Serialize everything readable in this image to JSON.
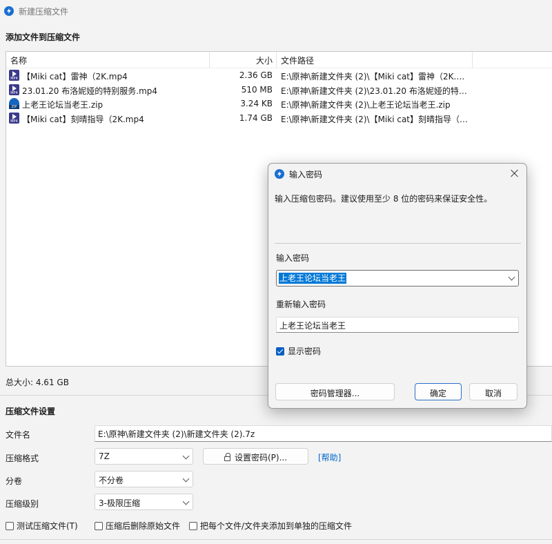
{
  "window": {
    "title": "新建压缩文件"
  },
  "add_section": {
    "title": "添加文件到压缩文件"
  },
  "file_list": {
    "columns": {
      "name": "名称",
      "size": "大小",
      "path": "文件路径"
    },
    "rows": [
      {
        "icon": "mp4-file-icon",
        "name": "【Miki cat】雷神（2K.mp4",
        "size": "2.36 GB",
        "path": "E:\\原神\\新建文件夹 (2)\\【Miki cat】雷神（2K.mp4"
      },
      {
        "icon": "mp4-file-icon",
        "name": "23.01.20 布洛妮娅的特别服务.mp4",
        "size": "510 MB",
        "path": "E:\\原神\\新建文件夹 (2)\\23.01.20 布洛妮娅的特别..."
      },
      {
        "icon": "zip-file-icon",
        "name": "上老王论坛当老王.zip",
        "size": "3.24 KB",
        "path": "E:\\原神\\新建文件夹 (2)\\上老王论坛当老王.zip"
      },
      {
        "icon": "mp4-file-icon",
        "name": "【Miki cat】刻晴指导（2K.mp4",
        "size": "1.74 GB",
        "path": "E:\\原神\\新建文件夹 (2)\\【Miki cat】刻晴指导（2..."
      }
    ]
  },
  "total_size": "总大小: 4.61 GB",
  "settings": {
    "title": "压缩文件设置",
    "filename_label": "文件名",
    "filename_value": "E:\\原神\\新建文件夹 (2)\\新建文件夹 (2).7z",
    "format_label": "压缩格式",
    "format_value": "7Z",
    "set_password_button": "设置密码(P)...",
    "help_link": "[帮助]",
    "volume_label": "分卷",
    "volume_value": "不分卷",
    "level_label": "压缩级别",
    "level_value": "3-极限压缩",
    "test_checkbox": "测试压缩文件(T)",
    "delete_checkbox": "压缩后删除原始文件",
    "separate_checkbox": "把每个文件/文件夹添加到单独的压缩文件"
  },
  "password_dialog": {
    "title": "输入密码",
    "description": "输入压缩包密码。建议使用至少 8 位的密码来保证安全性。",
    "password_label": "输入密码",
    "password_value": "上老王论坛当老王",
    "confirm_label": "重新输入密码",
    "confirm_value": "上老王论坛当老王",
    "show_password": "显示密码",
    "manager_button": "密码管理器...",
    "ok_button": "确定",
    "cancel_button": "取消"
  }
}
